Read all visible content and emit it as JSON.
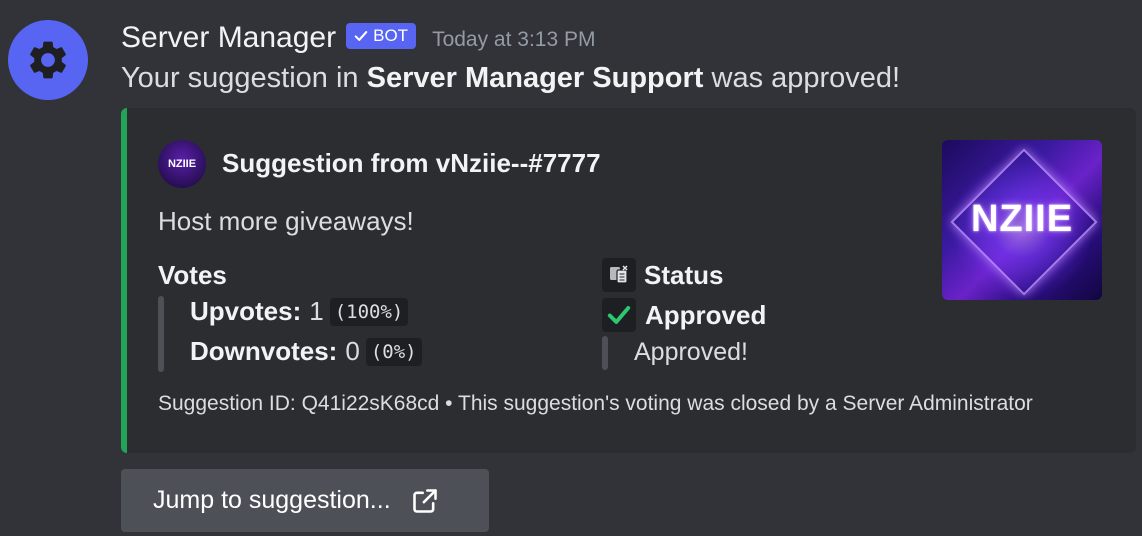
{
  "message": {
    "author": "Server Manager",
    "bot_tag": "BOT",
    "timestamp": "Today at 3:13 PM",
    "text_before": "Your suggestion in ",
    "server_name": "Server Manager Support",
    "text_after": " was approved!"
  },
  "embed": {
    "accent_color": "#23a559",
    "author_icon_text": "NZIIE",
    "author_name": "Suggestion from vNziie--#7777",
    "description": "Host more giveaways!",
    "votes": {
      "title": "Votes",
      "upvotes_label": "Upvotes:",
      "upvotes_value": "1",
      "upvotes_percent": "(100%)",
      "downvotes_label": "Downvotes:",
      "downvotes_value": "0",
      "downvotes_percent": "(0%)"
    },
    "status": {
      "title": "Status",
      "label": "Approved",
      "text": "Approved!"
    },
    "thumbnail_text": "NZIIE",
    "footer": "Suggestion ID: Q41i22sK68cd • This suggestion's voting was closed by a Server Administrator"
  },
  "button": {
    "label": "Jump to suggestion..."
  },
  "icons": {
    "avatar": "gear-icon",
    "bot_check": "checkmark-icon",
    "status": "clipboard-icon",
    "approved": "green-checkmark-icon",
    "external_link": "external-link-icon"
  },
  "colors": {
    "background": "#313338",
    "embed_background": "#2b2d31",
    "blurple": "#5865f2",
    "approved_green": "#2dc770"
  }
}
